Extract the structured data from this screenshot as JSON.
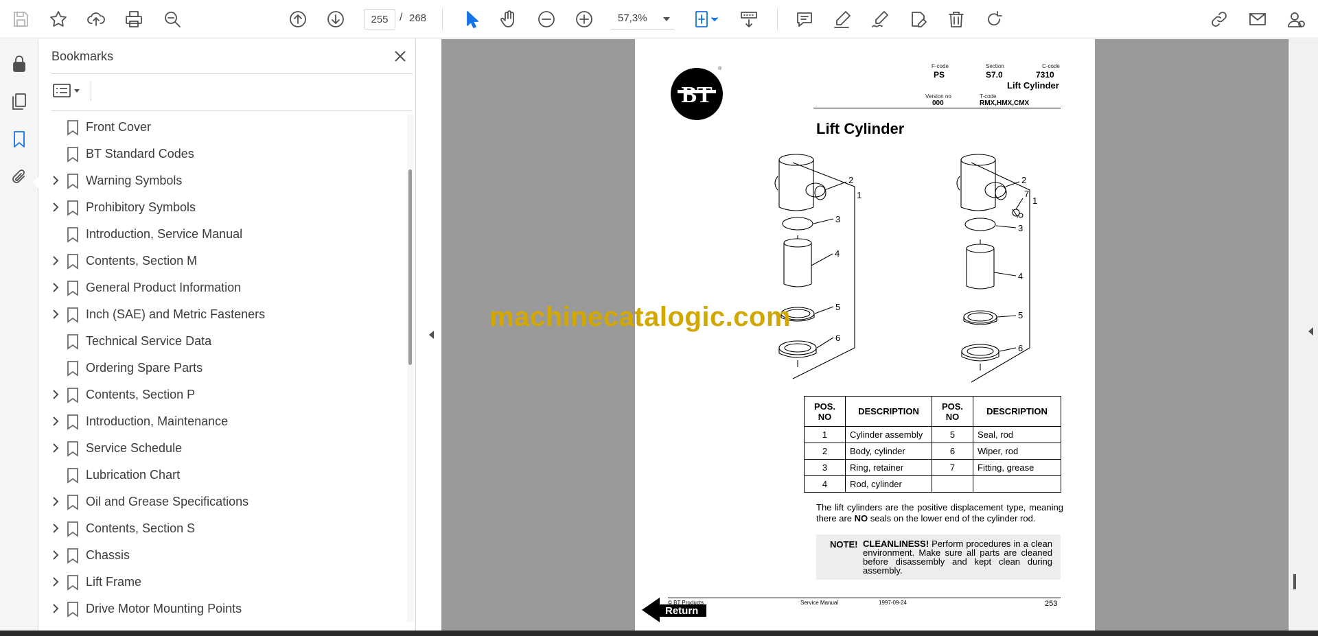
{
  "toolbar": {
    "page_current": "255",
    "page_separator": "/",
    "page_total": "268",
    "zoom": "57,3%",
    "accent_color": "#1473e6"
  },
  "bookmarks_panel": {
    "title": "Bookmarks",
    "items": [
      {
        "label": "Front Cover",
        "expandable": false
      },
      {
        "label": "BT Standard Codes",
        "expandable": false
      },
      {
        "label": "Warning Symbols",
        "expandable": true
      },
      {
        "label": "Prohibitory Symbols",
        "expandable": true
      },
      {
        "label": "Introduction, Service Manual",
        "expandable": false
      },
      {
        "label": "Contents, Section M",
        "expandable": true
      },
      {
        "label": "General Product Information",
        "expandable": true
      },
      {
        "label": "Inch (SAE) and Metric Fasteners",
        "expandable": true
      },
      {
        "label": "Technical Service Data",
        "expandable": false
      },
      {
        "label": "Ordering Spare Parts",
        "expandable": false
      },
      {
        "label": "Contents, Section P",
        "expandable": true
      },
      {
        "label": "Introduction, Maintenance",
        "expandable": true
      },
      {
        "label": "Service Schedule",
        "expandable": true
      },
      {
        "label": "Lubrication Chart",
        "expandable": false
      },
      {
        "label": "Oil and Grease Specifications",
        "expandable": true
      },
      {
        "label": "Contents, Section S",
        "expandable": true
      },
      {
        "label": "Chassis",
        "expandable": true
      },
      {
        "label": "Lift Frame",
        "expandable": true
      },
      {
        "label": "Drive Motor Mounting Points",
        "expandable": true
      }
    ]
  },
  "document": {
    "logo_text": "BT",
    "registered_mark": "®",
    "header": {
      "fcode_label": "F-code",
      "fcode_value": "PS",
      "section_label": "Section",
      "section_value": "S7.0",
      "ccode_label": "C-code",
      "ccode_value": "7310",
      "subtitle": "Lift Cylinder",
      "version_label": "Version no",
      "version_value": "000",
      "tcode_label": "T-code",
      "tcode_value": "RMX,HMX,CMX"
    },
    "title": "Lift Cylinder",
    "callouts_left": [
      "1",
      "2",
      "3",
      "4",
      "5",
      "6"
    ],
    "callouts_right": [
      "1",
      "2",
      "7",
      "3",
      "4",
      "5",
      "6"
    ],
    "table": {
      "headers": [
        "POS. NO",
        "DESCRIPTION",
        "POS. NO",
        "DESCRIPTION"
      ],
      "rows": [
        [
          "1",
          "Cylinder assembly",
          "5",
          "Seal, rod"
        ],
        [
          "2",
          "Body, cylinder",
          "6",
          "Wiper, rod"
        ],
        [
          "3",
          "Ring, retainer",
          "7",
          "Fitting, grease"
        ],
        [
          "4",
          "Rod, cylinder",
          "",
          ""
        ]
      ]
    },
    "paragraph_before": "The lift cylinders are the positive displacement type, meaning there are ",
    "paragraph_bold": "NO",
    "paragraph_after": " seals on the lower end of the cylinder rod.",
    "note_label": "NOTE!",
    "note_bold": "CLEANLINESS!",
    "note_text": " Perform procedures in a clean environment. Make sure all parts are cleaned before disassembly and kept clean during assembly.",
    "footer": {
      "copyright": "© BT Products",
      "manual": "Service Manual",
      "date": "1997-09-24",
      "page": "253"
    },
    "return_label": "Return",
    "watermark": "machinecatalogic.com"
  }
}
